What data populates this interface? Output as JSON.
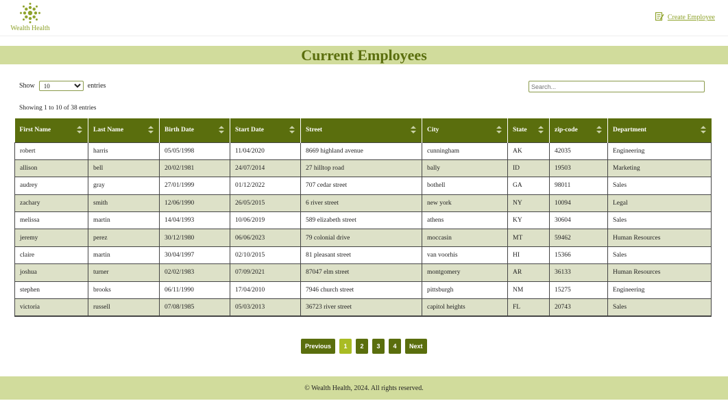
{
  "header": {
    "brand": "Wealth Health",
    "create_link": "Create Employee"
  },
  "page": {
    "title": "Current Employees"
  },
  "controls": {
    "show_label": "Show",
    "entries_label": "entries",
    "page_length": "10",
    "search_placeholder": "Search...",
    "info": "Showing 1 to 10 of 38 entries"
  },
  "table": {
    "columns": [
      "First Name",
      "Last Name",
      "Birth Date",
      "Start Date",
      "Street",
      "City",
      "State",
      "zip-code",
      "Department"
    ],
    "rows": [
      [
        "robert",
        "harris",
        "05/05/1998",
        "11/04/2020",
        "8669 highland avenue",
        "cunningham",
        "AK",
        "42035",
        "Engineering"
      ],
      [
        "allison",
        "bell",
        "20/02/1981",
        "24/07/2014",
        "27 hilltop road",
        "bally",
        "ID",
        "19503",
        "Marketing"
      ],
      [
        "audrey",
        "gray",
        "27/01/1999",
        "01/12/2022",
        "707 cedar street",
        "bothell",
        "GA",
        "98011",
        "Sales"
      ],
      [
        "zachary",
        "smith",
        "12/06/1990",
        "26/05/2015",
        "6 river street",
        "new york",
        "NY",
        "10094",
        "Legal"
      ],
      [
        "melissa",
        "martin",
        "14/04/1993",
        "10/06/2019",
        "589 elizabeth street",
        "athens",
        "KY",
        "30604",
        "Sales"
      ],
      [
        "jeremy",
        "perez",
        "30/12/1980",
        "06/06/2023",
        "79 colonial drive",
        "moccasin",
        "MT",
        "59462",
        "Human Resources"
      ],
      [
        "claire",
        "martin",
        "30/04/1997",
        "02/10/2015",
        "81 pleasant street",
        "van voorhis",
        "HI",
        "15366",
        "Sales"
      ],
      [
        "joshua",
        "turner",
        "02/02/1983",
        "07/09/2021",
        "87047 elm street",
        "montgomery",
        "AR",
        "36133",
        "Human Resources"
      ],
      [
        "stephen",
        "brooks",
        "06/11/1990",
        "17/04/2010",
        "7946 church street",
        "pittsburgh",
        "NM",
        "15275",
        "Engineering"
      ],
      [
        "victoria",
        "russell",
        "07/08/1985",
        "05/03/2013",
        "36723 river street",
        "capitol heights",
        "FL",
        "20743",
        "Sales"
      ]
    ]
  },
  "pagination": {
    "previous": "Previous",
    "pages": [
      "1",
      "2",
      "3",
      "4"
    ],
    "next": "Next",
    "current": "1"
  },
  "footer": {
    "text": "© Wealth Health, 2024. All rights reserved."
  },
  "colors": {
    "primary": "#5a6e0d",
    "accent": "#a9bc24",
    "band": "#d1dc9c",
    "row_alt": "#dde1c8"
  },
  "icons": {
    "logo": "flower-logo-icon",
    "create": "edit-document-icon"
  }
}
